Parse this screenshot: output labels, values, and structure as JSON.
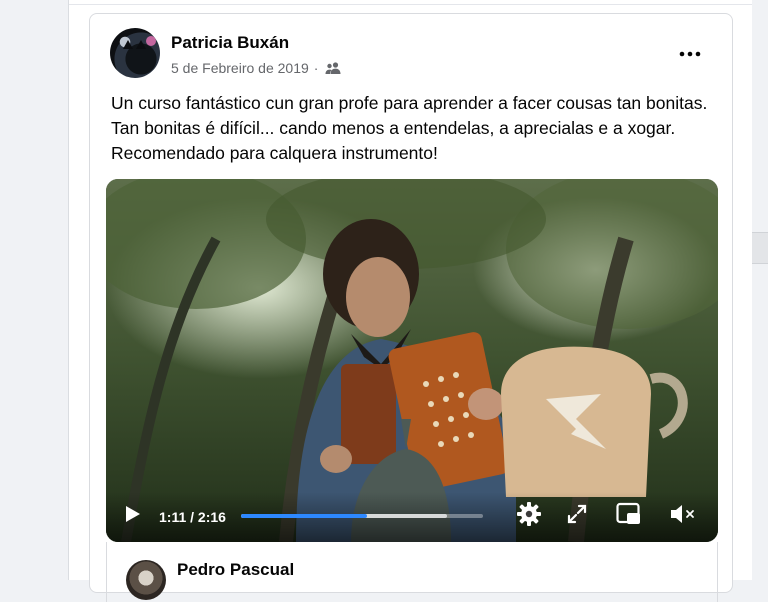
{
  "post": {
    "author": "Patricia Buxán",
    "date": "5 de Febreiro de 2019",
    "separator": "·",
    "audience_icon": "friends-icon",
    "body": "Un curso fantástico cun gran profe para aprender a facer cousas tan bonitas. Tan bonitas é difícil... cando menos a entendelas, a aprecialas e a xogar. Recomendado para calquera instrumento!"
  },
  "video": {
    "time_current": "1:11",
    "time_separator": "/",
    "time_total": "2:16",
    "progress_fraction": 0.522,
    "buffered_fraction": 0.85,
    "played_color": "#2d88ff",
    "icons": [
      "play-icon",
      "settings-icon",
      "fullscreen-icon",
      "picture-in-picture-icon",
      "mute-icon"
    ]
  },
  "shared_post": {
    "author": "Pedro Pascual"
  }
}
